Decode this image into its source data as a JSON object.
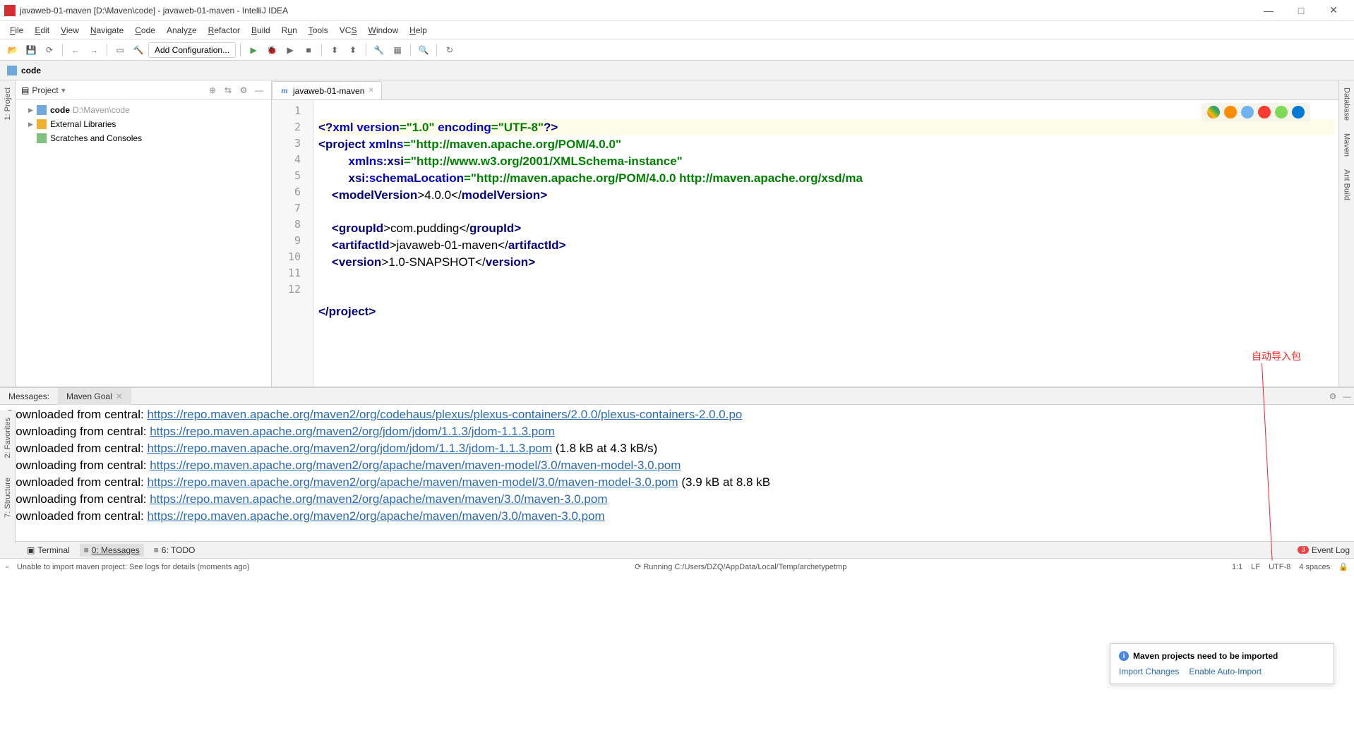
{
  "titlebar": {
    "text": "javaweb-01-maven [D:\\Maven\\code] - javaweb-01-maven - IntelliJ IDEA"
  },
  "menu": [
    "File",
    "Edit",
    "View",
    "Navigate",
    "Code",
    "Analyze",
    "Refactor",
    "Build",
    "Run",
    "Tools",
    "VCS",
    "Window",
    "Help"
  ],
  "toolbar": {
    "addcfg": "Add Configuration..."
  },
  "breadcrumb": {
    "item": "code"
  },
  "project": {
    "title": "Project",
    "items": [
      {
        "name": "code",
        "path": "D:\\Maven\\code",
        "icon": "folder"
      },
      {
        "name": "External Libraries",
        "icon": "lib"
      },
      {
        "name": "Scratches and Consoles",
        "icon": "scr"
      }
    ]
  },
  "tab": {
    "name": "javaweb-01-maven"
  },
  "code_lines": 12,
  "code": {
    "l1a": "<?",
    "l1b": "xml version",
    "l1c": "=",
    "l1d": "\"1.0\"",
    "l1e": " encoding",
    "l1f": "=",
    "l1g": "\"UTF-8\"",
    "l1h": "?>",
    "l2a": "<",
    "l2b": "project ",
    "l2c": "xmlns",
    "l2d": "=",
    "l2e": "\"http://maven.apache.org/POM/4.0.0\"",
    "l3a": "         ",
    "l3b": "xmlns:",
    "l3c": "xsi",
    "l3d": "=",
    "l3e": "\"http://www.w3.org/2001/XMLSchema-instance\"",
    "l4a": "         ",
    "l4b": "xsi",
    "l4c": ":schemaLocation",
    "l4d": "=",
    "l4e": "\"http://maven.apache.org/POM/4.0.0 http://maven.apache.org/xsd/ma",
    "l5a": "    <",
    "l5b": "modelVersion",
    "l5c": ">4.0.0</",
    "l5d": "modelVersion",
    "l5e": ">",
    "l7a": "    <",
    "l7b": "groupId",
    "l7c": ">com.pudding</",
    "l7d": "groupId",
    "l7e": ">",
    "l8a": "    <",
    "l8b": "artifactId",
    "l8c": ">javaweb-01-maven</",
    "l8d": "artifactId",
    "l8e": ">",
    "l9a": "    <",
    "l9b": "version",
    "l9c": ">1.0-SNAPSHOT</",
    "l9d": "version",
    "l9e": ">",
    "l12a": "</",
    "l12b": "project",
    "l12c": ">"
  },
  "messages": {
    "tab1": "Messages:",
    "tab2": "Maven Goal",
    "lines": [
      {
        "pre": "Downloaded from central: ",
        "url": "https://repo.maven.apache.org/maven2/org/codehaus/plexus/plexus-containers/2.0.0/plexus-containers-2.0.0.po",
        "post": ""
      },
      {
        "pre": "Downloading from central: ",
        "url": "https://repo.maven.apache.org/maven2/org/jdom/jdom/1.1.3/jdom-1.1.3.pom",
        "post": ""
      },
      {
        "pre": "Downloaded from central: ",
        "url": "https://repo.maven.apache.org/maven2/org/jdom/jdom/1.1.3/jdom-1.1.3.pom",
        "post": " (1.8 kB at 4.3 kB/s)"
      },
      {
        "pre": "Downloading from central: ",
        "url": "https://repo.maven.apache.org/maven2/org/apache/maven/maven-model/3.0/maven-model-3.0.pom",
        "post": ""
      },
      {
        "pre": "Downloaded from central: ",
        "url": "https://repo.maven.apache.org/maven2/org/apache/maven/maven-model/3.0/maven-model-3.0.pom",
        "post": " (3.9 kB at 8.8 kB"
      },
      {
        "pre": "Downloading from central: ",
        "url": "https://repo.maven.apache.org/maven2/org/apache/maven/maven/3.0/maven-3.0.pom",
        "post": ""
      },
      {
        "pre": "Downloaded from central: ",
        "url": "https://repo.maven.apache.org/maven2/org/apache/maven/maven/3.0/maven-3.0.pom",
        "post": ""
      }
    ]
  },
  "bottom": {
    "terminal": "Terminal",
    "messages": "0: Messages",
    "todo": "6: TODO",
    "eventlog": "Event Log",
    "badge": "3"
  },
  "status": {
    "left": "Unable to import maven project: See logs for details (moments ago)",
    "running": "Running C:/Users/DZQ/AppData/Local/Temp/archetypetmp",
    "pos": "1:1",
    "lf": "LF",
    "enc": "UTF-8",
    "indent": "4 spaces"
  },
  "notif": {
    "title": "Maven projects need to be imported",
    "link1": "Import Changes",
    "link2": "Enable Auto-Import"
  },
  "sidestrips": {
    "project": "1: Project",
    "fav": "2: Favorites",
    "struct": "7: Structure",
    "db": "Database",
    "maven": "Maven",
    "ant": "Ant Build"
  },
  "annotation": "自动导入包"
}
